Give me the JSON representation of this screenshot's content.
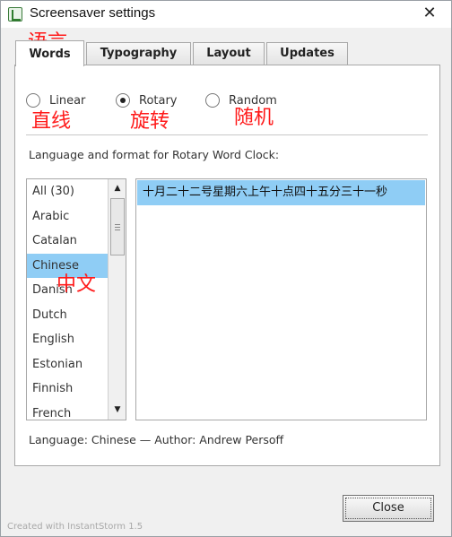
{
  "window": {
    "title": "Screensaver settings"
  },
  "tabs": [
    {
      "label": "Words",
      "active": true
    },
    {
      "label": "Typography",
      "active": false
    },
    {
      "label": "Layout",
      "active": false
    },
    {
      "label": "Updates",
      "active": false
    }
  ],
  "mode": {
    "options": [
      {
        "label": "Linear",
        "checked": false
      },
      {
        "label": "Rotary",
        "checked": true
      },
      {
        "label": "Random",
        "checked": false
      }
    ]
  },
  "section_label": "Language and format for Rotary Word Clock:",
  "languages": {
    "items": [
      "All (30)",
      "Arabic",
      "Catalan",
      "Chinese",
      "Danish",
      "Dutch",
      "English",
      "Estonian",
      "Finnish",
      "French"
    ],
    "selected": "Chinese"
  },
  "output": {
    "text": "十月二十二号星期六上午十点四十五分三十一秒"
  },
  "status": "Language: Chinese — Author: Andrew Persoff",
  "close_button": {
    "label": "Close"
  },
  "footer": {
    "watermark": "Created with InstantStorm 1.5"
  },
  "annotations": {
    "words": "语言",
    "linear": "直线",
    "rotary": "旋转",
    "random": "随机",
    "chinese": "中文",
    "color": "#ff1a1a"
  },
  "colors": {
    "selection": "#8fcdf5",
    "accent_icon": "#2d7d2d"
  },
  "icons": {
    "app": "screensaver-app-icon",
    "close": "close-x-icon",
    "scroll_up": "triangle-up-icon",
    "scroll_down": "triangle-down-icon"
  }
}
